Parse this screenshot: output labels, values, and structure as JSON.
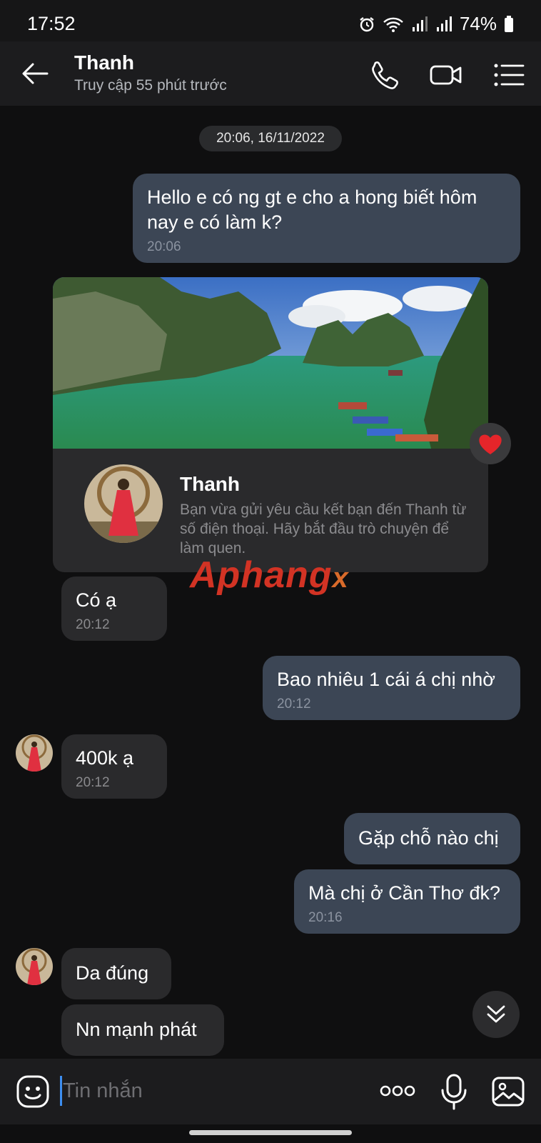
{
  "status_bar": {
    "time": "17:52",
    "battery": "74%",
    "icons": [
      "alarm-icon",
      "wifi-icon",
      "signal-icon",
      "signal-icon",
      "battery-icon"
    ]
  },
  "header": {
    "title": "Thanh",
    "subtitle": "Truy cập 55 phút trước",
    "icons": [
      "back-arrow-icon",
      "phone-icon",
      "video-call-icon",
      "menu-list-icon"
    ]
  },
  "chat": {
    "date_separator": "20:06, 16/11/2022",
    "card": {
      "name": "Thanh",
      "description": "Bạn vừa gửi yêu cầu kết bạn đến Thanh từ số điện thoại. Hãy bắt đầu trò chuyện để làm quen."
    },
    "messages": [
      {
        "direction": "out",
        "text": "Hello e có ng gt e cho a hong biết hôm nay e có làm k?",
        "time": "20:06"
      },
      {
        "direction": "in",
        "text": "Có ạ",
        "time": "20:12"
      },
      {
        "direction": "out",
        "text": "Bao nhiêu 1 cái á chị nhờ",
        "time": "20:12"
      },
      {
        "direction": "in",
        "text": "400k ạ",
        "time": "20:12"
      },
      {
        "direction": "out",
        "text": "Gặp chỗ nào chị",
        "time": ""
      },
      {
        "direction": "out",
        "text": "Mà chị ở Cần Thơ đk?",
        "time": "20:16"
      },
      {
        "direction": "in",
        "text": "Da đúng",
        "time": ""
      },
      {
        "direction": "in",
        "text": "Nn mạnh phát",
        "time": ""
      }
    ],
    "reaction": "heart-icon"
  },
  "watermark": {
    "part1": "Aphang",
    "part2": "x"
  },
  "input_bar": {
    "placeholder": "Tin nhắn",
    "value": "",
    "icons": [
      "emoji-icon",
      "more-dots-icon",
      "microphone-icon",
      "gallery-icon"
    ]
  },
  "colors": {
    "outgoing_bubble": "#3c4655",
    "incoming_bubble": "#2a2a2c",
    "background": "#0f0f10",
    "accent": "#3d8ef0"
  }
}
